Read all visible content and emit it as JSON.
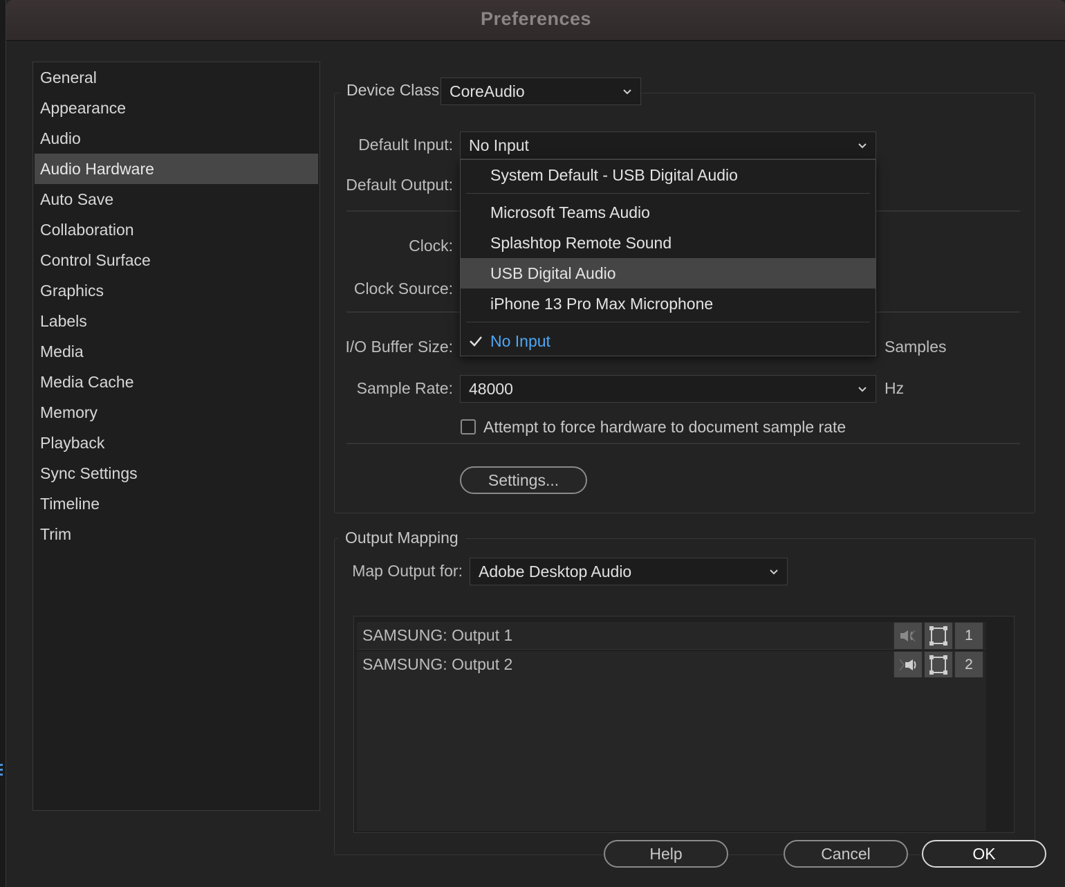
{
  "window": {
    "title": "Preferences"
  },
  "sidebar": {
    "items": [
      {
        "label": "General"
      },
      {
        "label": "Appearance"
      },
      {
        "label": "Audio"
      },
      {
        "label": "Audio Hardware",
        "selected": true
      },
      {
        "label": "Auto Save"
      },
      {
        "label": "Collaboration"
      },
      {
        "label": "Control Surface"
      },
      {
        "label": "Graphics"
      },
      {
        "label": "Labels"
      },
      {
        "label": "Media"
      },
      {
        "label": "Media Cache"
      },
      {
        "label": "Memory"
      },
      {
        "label": "Playback"
      },
      {
        "label": "Sync Settings"
      },
      {
        "label": "Timeline"
      },
      {
        "label": "Trim"
      }
    ]
  },
  "hardware": {
    "device_class_label": "Device Class:",
    "device_class_value": "CoreAudio",
    "default_input_label": "Default Input:",
    "default_input_value": "No Input",
    "default_output_label": "Default Output:",
    "clock_label": "Clock:",
    "clock_source_label": "Clock Source:",
    "io_buffer_label": "I/O Buffer Size:",
    "io_buffer_unit": "Samples",
    "sample_rate_label": "Sample Rate:",
    "sample_rate_value": "48000",
    "sample_rate_unit": "Hz",
    "force_rate_label": "Attempt to force hardware to document sample rate",
    "force_rate_checked": false,
    "settings_button": "Settings..."
  },
  "input_dropdown": {
    "items": [
      {
        "label": "System Default - USB Digital Audio"
      },
      {
        "label": "Microsoft Teams Audio"
      },
      {
        "label": "Splashtop Remote Sound"
      },
      {
        "label": "USB Digital Audio",
        "hovered": true
      },
      {
        "label": "iPhone 13 Pro Max Microphone"
      },
      {
        "label": "No Input",
        "checked": true
      }
    ],
    "accent_color": "#4ea7f5"
  },
  "output_mapping": {
    "legend": "Output Mapping",
    "map_for_label": "Map Output for:",
    "map_for_value": "Adobe Desktop Audio",
    "rows": [
      {
        "label": "SAMSUNG: Output 1",
        "channel": "1",
        "speaker_icon": "speaker-left-icon"
      },
      {
        "label": "SAMSUNG: Output 2",
        "channel": "2",
        "speaker_icon": "speaker-right-icon"
      }
    ]
  },
  "footer": {
    "help": "Help",
    "cancel": "Cancel",
    "ok": "OK"
  }
}
